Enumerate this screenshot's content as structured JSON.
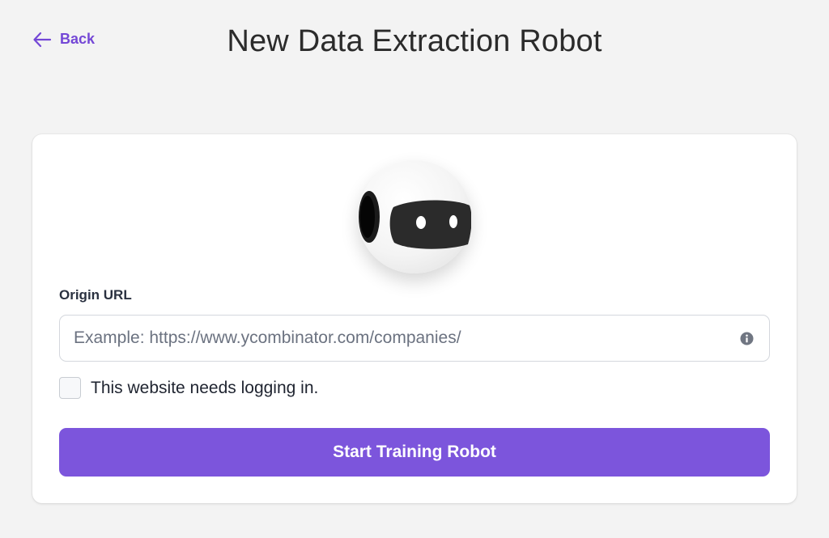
{
  "header": {
    "back_label": "Back",
    "title": "New Data Extraction Robot"
  },
  "form": {
    "origin_url_label": "Origin URL",
    "url_value": "",
    "url_placeholder": "Example: https://www.ycombinator.com/companies/",
    "login_checkbox_label": "This website needs logging in.",
    "login_checked": false,
    "submit_label": "Start Training Robot"
  },
  "icons": {
    "back": "arrow-left-icon",
    "avatar": "robot-icon",
    "info": "info-icon"
  },
  "colors": {
    "accent": "#7c55dc",
    "back_link": "#7447d6",
    "background": "#f3f3f3",
    "card": "#ffffff",
    "info_icon": "#707682"
  }
}
